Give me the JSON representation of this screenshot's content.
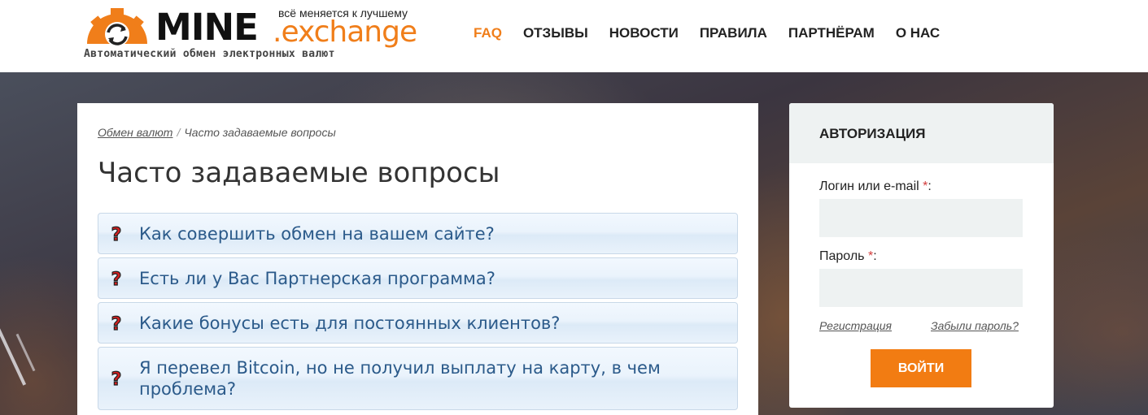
{
  "header": {
    "logo": {
      "mine": "MINE",
      "exchange": ".exchange",
      "tagline": "всё меняется к лучшему",
      "subtitle": "Автоматический обмен электронных валют"
    },
    "nav": [
      {
        "label": "FAQ",
        "active": true
      },
      {
        "label": "ОТЗЫВЫ",
        "active": false
      },
      {
        "label": "НОВОСТИ",
        "active": false
      },
      {
        "label": "ПРАВИЛА",
        "active": false
      },
      {
        "label": "ПАРТНЁРАМ",
        "active": false
      },
      {
        "label": "О НАС",
        "active": false
      }
    ]
  },
  "breadcrumb": {
    "home": "Обмен валют",
    "separator": "/",
    "current": "Часто задаваемые вопросы"
  },
  "main": {
    "title": "Часто задаваемые вопросы",
    "faq": [
      {
        "question": "Как совершить обмен на вашем сайте?"
      },
      {
        "question": "Есть ли у Вас Партнерская программа?"
      },
      {
        "question": "Какие бонусы есть для постоянных клиентов?"
      },
      {
        "question": "Я перевел Bitcoin, но не получил выплату на карту, в чем проблема?"
      }
    ]
  },
  "auth": {
    "title": "АВТОРИЗАЦИЯ",
    "login_label": "Логин или e-mail",
    "password_label": "Пароль",
    "required_mark": "*",
    "label_suffix": ":",
    "register_link": "Регистрация",
    "forgot_link": "Забыли пароль?",
    "submit_label": "ВОЙТИ"
  },
  "colors": {
    "accent": "#f07e1a",
    "faq_text": "#2b5a8a",
    "required": "#d23b3b"
  }
}
